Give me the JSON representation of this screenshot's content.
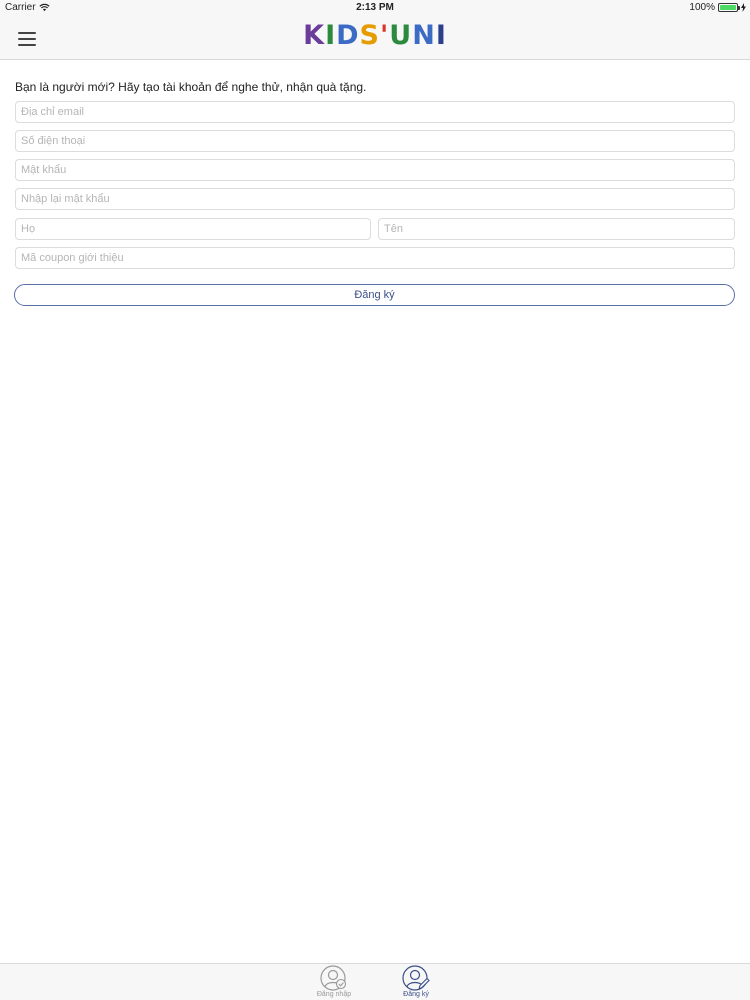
{
  "status": {
    "carrier": "Carrier",
    "time": "2:13 PM",
    "battery": "100%",
    "battery_level": 1.0
  },
  "nav": {
    "menu_icon": "hamburger-icon",
    "logo": {
      "letters": [
        {
          "char": "K",
          "color": "#6a3d9a"
        },
        {
          "char": "I",
          "color": "#2b8a3e"
        },
        {
          "char": "D",
          "color": "#3b6bc4"
        },
        {
          "char": "S",
          "color": "#e69b00"
        },
        {
          "char": "'",
          "color": "#d9342b"
        },
        {
          "char": "U",
          "color": "#2b8a3e"
        },
        {
          "char": "N",
          "color": "#3b6bc4"
        },
        {
          "char": "I",
          "color": "#2b3f8a"
        }
      ]
    }
  },
  "form": {
    "intro": "Bạn là người mới? Hãy tạo tài khoản để nghe thử, nhận quà tặng.",
    "email_placeholder": "Địa chỉ email",
    "phone_placeholder": "Số điện thoại",
    "password_placeholder": "Mật khẩu",
    "password_confirm_placeholder": "Nhập lại mật khẩu",
    "last_name_placeholder": "Họ",
    "first_name_placeholder": "Tên",
    "coupon_placeholder": "Mã coupon giới thiệu",
    "submit_label": "Đăng ký"
  },
  "tabs": {
    "login": {
      "label": "Đăng nhập",
      "icon": "user-check-icon"
    },
    "register": {
      "label": "Đăng ký",
      "icon": "user-edit-icon",
      "active": true
    }
  },
  "colors": {
    "accent": "#3a4f8a",
    "border": "#dcdcdc",
    "battery": "#4cd964"
  }
}
